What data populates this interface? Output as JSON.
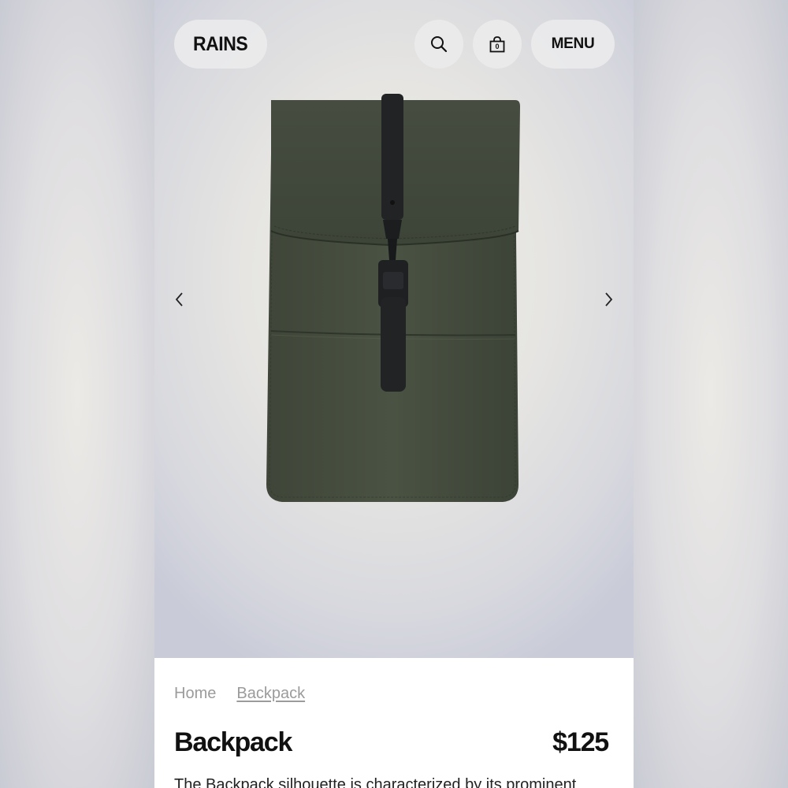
{
  "header": {
    "logo": "RAINS",
    "bag_count": "0",
    "menu_label": "MENU",
    "icons": [
      "search-icon",
      "bag-icon"
    ]
  },
  "carousel": {
    "prev_icon": "chevron-left-icon",
    "next_icon": "chevron-right-icon",
    "image_subject": "green backpack with black strap"
  },
  "breadcrumb": {
    "home": "Home",
    "current": "Backpack"
  },
  "product": {
    "name": "Backpack",
    "price": "$125",
    "description": "The Backpack silhouette is characterized by its prominent"
  },
  "colors": {
    "backpack": "#434a3c",
    "strap": "#1e1f21",
    "text": "#111111",
    "muted": "#9b9b9b"
  }
}
